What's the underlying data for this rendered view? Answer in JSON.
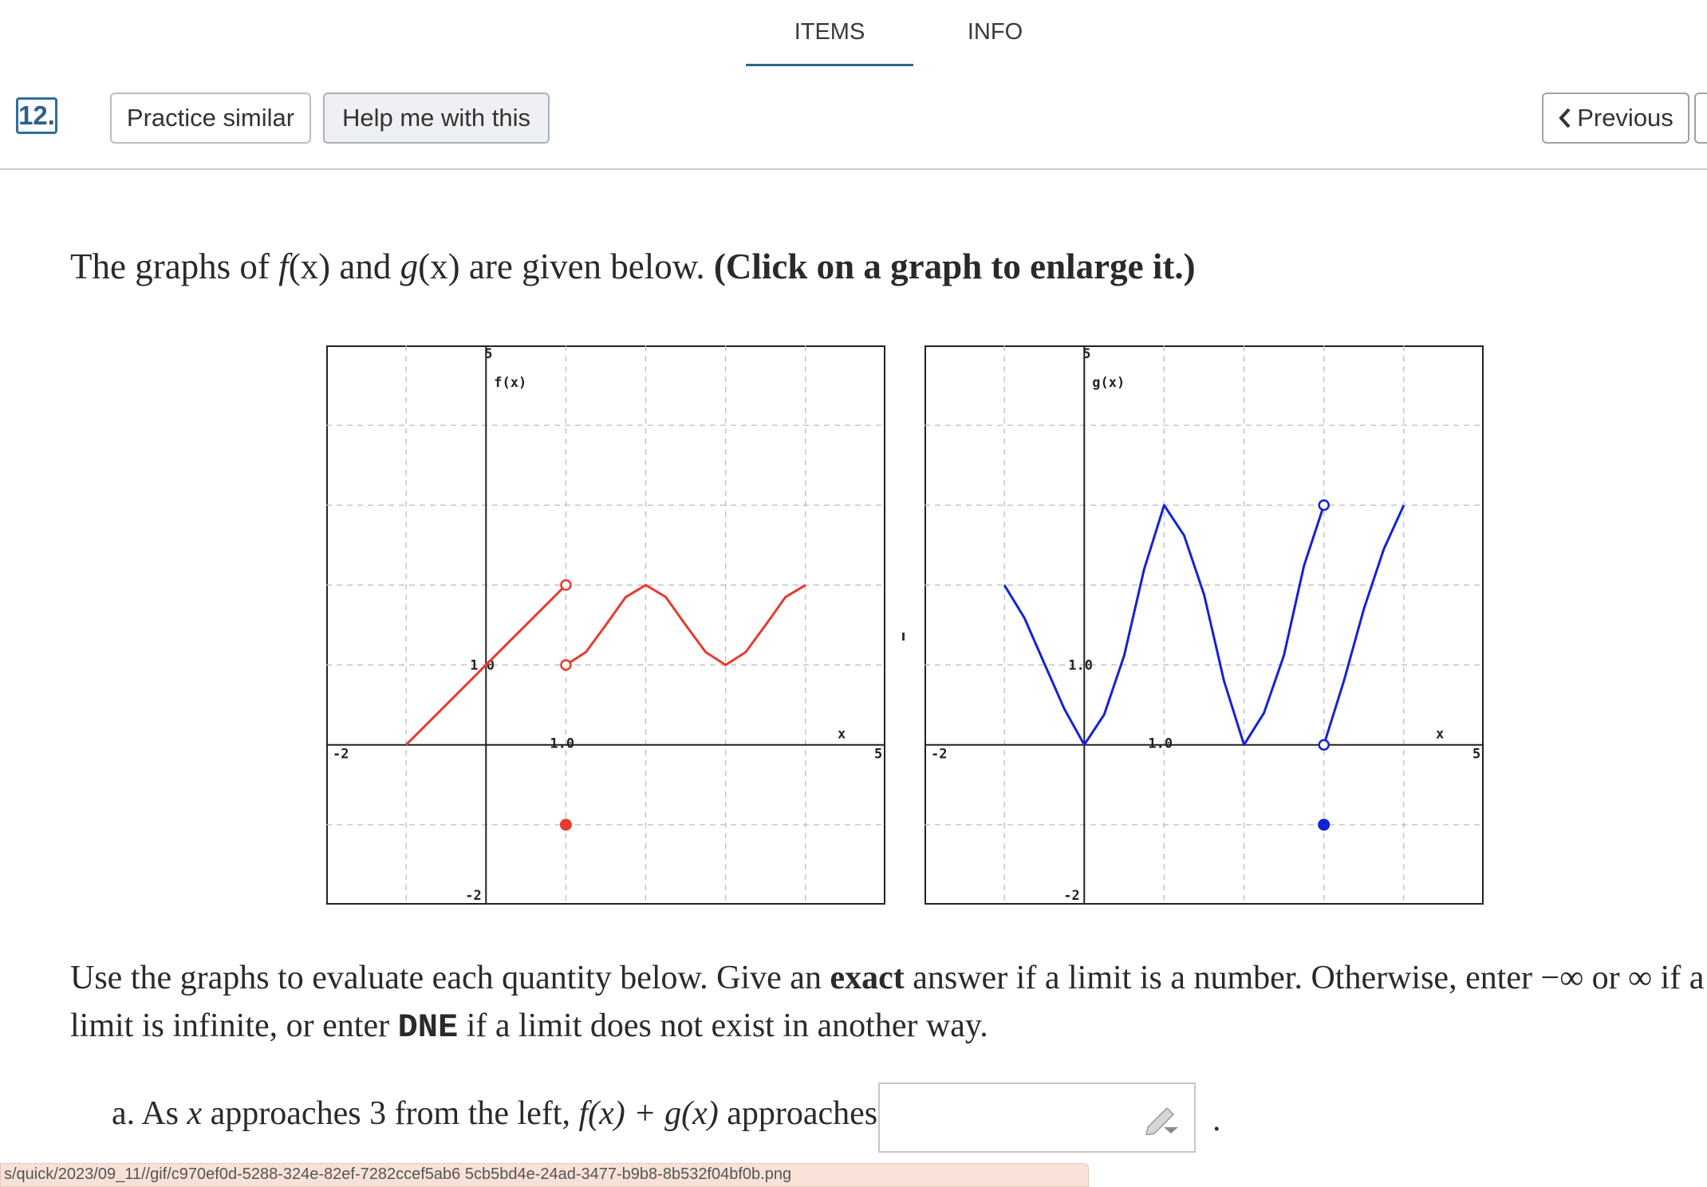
{
  "tabs": {
    "items": "ITEMS",
    "info": "INFO"
  },
  "toolbar": {
    "question_number": "12.",
    "practice_label": "Practice similar",
    "help_label": "Help me with this",
    "previous_label": "Previous"
  },
  "intro": {
    "lead": "The graphs of ",
    "f": "f",
    "x1": "(x)",
    "and": " and ",
    "g": "g",
    "x2": "(x)",
    "mid": " are given below. ",
    "bold": "(Click on a graph to enlarge it.)"
  },
  "instructions": {
    "p1": "Use the graphs to evaluate each quantity below. Give an ",
    "exact": "exact",
    "p2": " answer if a limit is a number. Otherwise, enter ",
    "neg_inf": "−∞",
    "or": " or ",
    "inf": "∞",
    "p3": " if a limit is infinite, or enter ",
    "dne": "DNE",
    "p4": " if a limit does not exist in another way."
  },
  "part_a": {
    "prefix": "a. As ",
    "x": "x",
    "mid": " approaches ",
    "num": "3",
    "side": " from the left, ",
    "expr": "f(x) + g(x)",
    "suffix": " approaches",
    "answer_value": "",
    "dot": "."
  },
  "url_text": "s/quick/2023/09_11//gif/c970ef0d-5288-324e-82ef-7282ccef5ab6     5cb5bd4e-24ad-3477-b9b8-8b532f04bf0b.png",
  "graphs": [
    {
      "name": "f",
      "label": "f(x)",
      "color": "#e63b2e",
      "x_axis_label": "x",
      "tick_labels": {
        "xmin": "-2",
        "xmax": "5",
        "ymax": "5",
        "ymin": "-2",
        "x_unit": "1.0",
        "y_unit": "1.0"
      },
      "xlim": [
        -2,
        5
      ],
      "ylim": [
        -2,
        5
      ],
      "segments": [
        {
          "points": [
            [
              -1,
              0
            ],
            [
              1,
              2
            ]
          ]
        },
        {
          "points": [
            [
              1,
              1
            ],
            [
              1.25,
              1.16
            ],
            [
              1.5,
              1.5
            ],
            [
              1.75,
              1.85
            ],
            [
              2,
              2
            ],
            [
              2.25,
              1.85
            ],
            [
              2.5,
              1.5
            ],
            [
              2.75,
              1.16
            ],
            [
              3,
              1
            ],
            [
              3.25,
              1.16
            ],
            [
              3.5,
              1.5
            ],
            [
              3.75,
              1.85
            ],
            [
              4,
              2
            ]
          ]
        }
      ],
      "open_points": [
        [
          1,
          2
        ],
        [
          1,
          1
        ]
      ],
      "closed_points": [
        [
          1,
          -1
        ]
      ]
    },
    {
      "name": "g",
      "label": "g(x)",
      "color": "#1422d6",
      "x_axis_label": "x",
      "tick_labels": {
        "xmin": "-2",
        "xmax": "5",
        "ymax": "5",
        "ymin": "-2",
        "x_unit": "1.0",
        "y_unit": "1.0"
      },
      "xlim": [
        -2,
        5
      ],
      "ylim": [
        -2,
        5
      ],
      "segments": [
        {
          "points": [
            [
              -1,
              2
            ],
            [
              -0.75,
              1.59
            ],
            [
              -0.5,
              1.02
            ],
            [
              -0.25,
              0.45
            ],
            [
              0,
              0
            ],
            [
              0.25,
              0.38
            ],
            [
              0.5,
              1.12
            ],
            [
              0.75,
              2.2
            ],
            [
              1,
              3
            ],
            [
              1.25,
              2.62
            ],
            [
              1.5,
              1.88
            ],
            [
              1.75,
              0.8
            ],
            [
              2,
              0
            ],
            [
              2.25,
              0.4
            ],
            [
              2.5,
              1.12
            ],
            [
              2.75,
              2.24
            ],
            [
              3,
              3
            ]
          ]
        },
        {
          "points": [
            [
              3,
              0
            ],
            [
              3.25,
              0.8
            ],
            [
              3.5,
              1.7
            ],
            [
              3.75,
              2.45
            ],
            [
              4,
              3
            ]
          ]
        }
      ],
      "open_points": [
        [
          3,
          3
        ],
        [
          3,
          0
        ]
      ],
      "closed_points": [
        [
          3,
          -1
        ]
      ]
    }
  ]
}
